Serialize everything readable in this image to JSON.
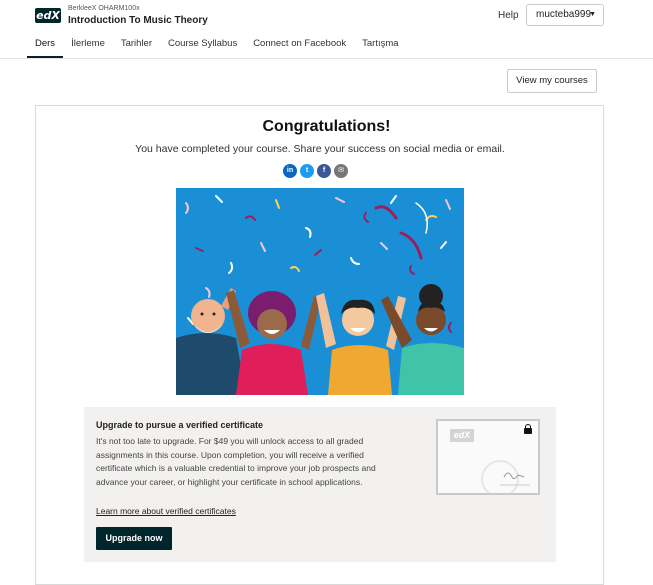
{
  "header": {
    "logo_text": "edX",
    "course_org": "BerkleeX OHARM100x",
    "course_title": "Introduction To Music Theory",
    "help_label": "Help",
    "username": "mucteba999",
    "caret_icon": "chevron-down-icon"
  },
  "tabs": [
    {
      "label": "Ders",
      "active": true
    },
    {
      "label": "İlerleme"
    },
    {
      "label": "Tarihler"
    },
    {
      "label": "Course Syllabus"
    },
    {
      "label": "Connect on Facebook"
    },
    {
      "label": "Tartışma"
    }
  ],
  "view_courses_label": "View my courses",
  "celebration": {
    "heading": "Congratulations!",
    "message": "You have completed your course. Share your success on social media or email.",
    "share_icons": [
      "linkedin-icon",
      "twitter-icon",
      "facebook-icon",
      "email-icon"
    ]
  },
  "upgrade": {
    "title": "Upgrade to pursue a verified certificate",
    "body": "It's not too late to upgrade. For $49 you will unlock access to all graded assignments in this course. Upon completion, you will receive a verified certificate which is a valuable credential to improve your job prospects and advance your career, or highlight your certificate in school applications.",
    "link_label": "Learn more about verified certificates",
    "button_label": "Upgrade now",
    "certificate_logo": "edX"
  },
  "colors": {
    "brand_dark": "#00262b",
    "celebration_bg": "#1a8fd6",
    "upgrade_bg": "#f2f1f0"
  }
}
